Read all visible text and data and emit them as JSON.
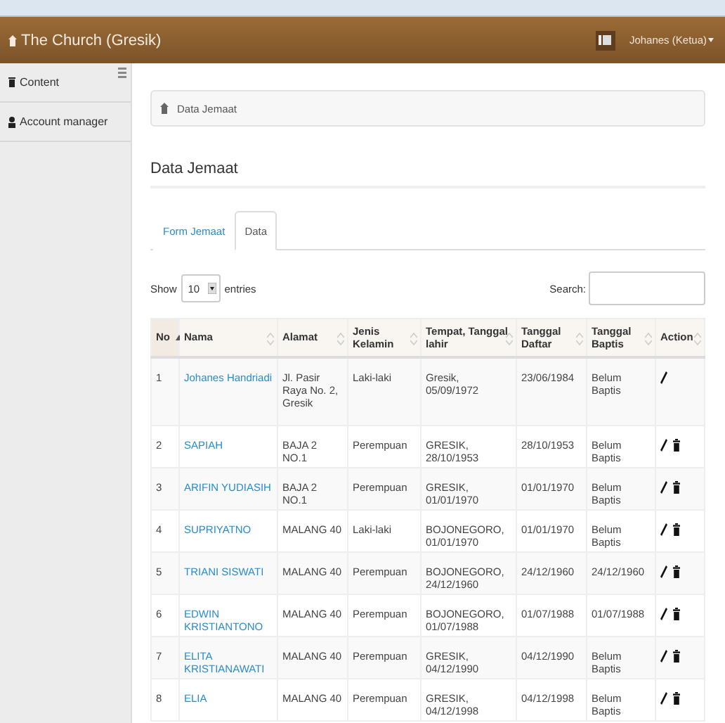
{
  "header": {
    "brand": "The Church (Gresik)",
    "user": "Johanes (Ketua)"
  },
  "sidebar": {
    "items": [
      {
        "label": "Content",
        "kind": "content"
      },
      {
        "label": "Account manager",
        "kind": "user"
      }
    ]
  },
  "breadcrumb": "Data Jemaat",
  "title": "Data Jemaat",
  "tabs": [
    {
      "label": "Form Jemaat",
      "selected": false
    },
    {
      "label": "Data",
      "selected": true
    }
  ],
  "length": {
    "before": "Show",
    "value": "10",
    "after": "entries"
  },
  "search": {
    "label": "Search:"
  },
  "table": {
    "columns": [
      {
        "label": "No",
        "sorted": true
      },
      {
        "label": "Nama",
        "sorted": false
      },
      {
        "label": "Alamat",
        "sorted": false
      },
      {
        "label": "Jenis Kelamin",
        "sorted": false
      },
      {
        "label": "Tempat, Tanggal lahir",
        "sorted": false
      },
      {
        "label": "Tanggal Daftar",
        "sorted": false
      },
      {
        "label": "Tanggal Baptis",
        "sorted": false
      },
      {
        "label": "Action",
        "sorted": false
      }
    ],
    "rows": [
      {
        "cells": [
          "1",
          "Johanes Handriadi",
          "Jl. Pasir Raya No. 2, Gresik",
          "Laki-laki",
          "Gresik, 05/09/1972",
          "23/06/1984",
          "Belum Baptis"
        ],
        "actions": [
          {
            "kind": "edit"
          }
        ]
      },
      {
        "cells": [
          "2",
          "SAPIAH",
          "BAJA 2 NO.1",
          "Perempuan",
          "GRESIK, 28/10/1953",
          "28/10/1953",
          "Belum Baptis"
        ],
        "actions": [
          {
            "kind": "edit"
          },
          {
            "kind": "delete"
          }
        ]
      },
      {
        "cells": [
          "3",
          "ARIFIN YUDIASIH",
          "BAJA 2 NO.1",
          "Perempuan",
          "GRESIK, 01/01/1970",
          "01/01/1970",
          "Belum Baptis"
        ],
        "actions": [
          {
            "kind": "edit"
          },
          {
            "kind": "delete"
          }
        ]
      },
      {
        "cells": [
          "4",
          "SUPRIYATNO",
          "MALANG 40",
          "Laki-laki",
          "BOJONEGORO, 01/01/1970",
          "01/01/1970",
          "Belum Baptis"
        ],
        "actions": [
          {
            "kind": "edit"
          },
          {
            "kind": "delete"
          }
        ]
      },
      {
        "cells": [
          "5",
          "TRIANI SISWATI",
          "MALANG 40",
          "Perempuan",
          "BOJONEGORO, 24/12/1960",
          "24/12/1960",
          "24/12/1960"
        ],
        "actions": [
          {
            "kind": "edit"
          },
          {
            "kind": "delete"
          }
        ]
      },
      {
        "cells": [
          "6",
          "EDWIN KRISTIANTONO",
          "MALANG 40",
          "Perempuan",
          "BOJONEGORO, 01/07/1988",
          "01/07/1988",
          "01/07/1988"
        ],
        "actions": [
          {
            "kind": "edit"
          },
          {
            "kind": "delete"
          }
        ]
      },
      {
        "cells": [
          "7",
          "ELITA KRISTIANAWATI",
          "MALANG 40",
          "Perempuan",
          "GRESIK, 04/12/1990",
          "04/12/1990",
          "Belum Baptis"
        ],
        "actions": [
          {
            "kind": "edit"
          },
          {
            "kind": "delete"
          }
        ]
      },
      {
        "cells": [
          "8",
          "ELIA",
          "MALANG 40",
          "Perempuan",
          "GRESIK, 04/12/1998",
          "04/12/1998",
          "Belum Baptis"
        ],
        "actions": [
          {
            "kind": "edit"
          },
          {
            "kind": "delete"
          }
        ]
      }
    ]
  }
}
